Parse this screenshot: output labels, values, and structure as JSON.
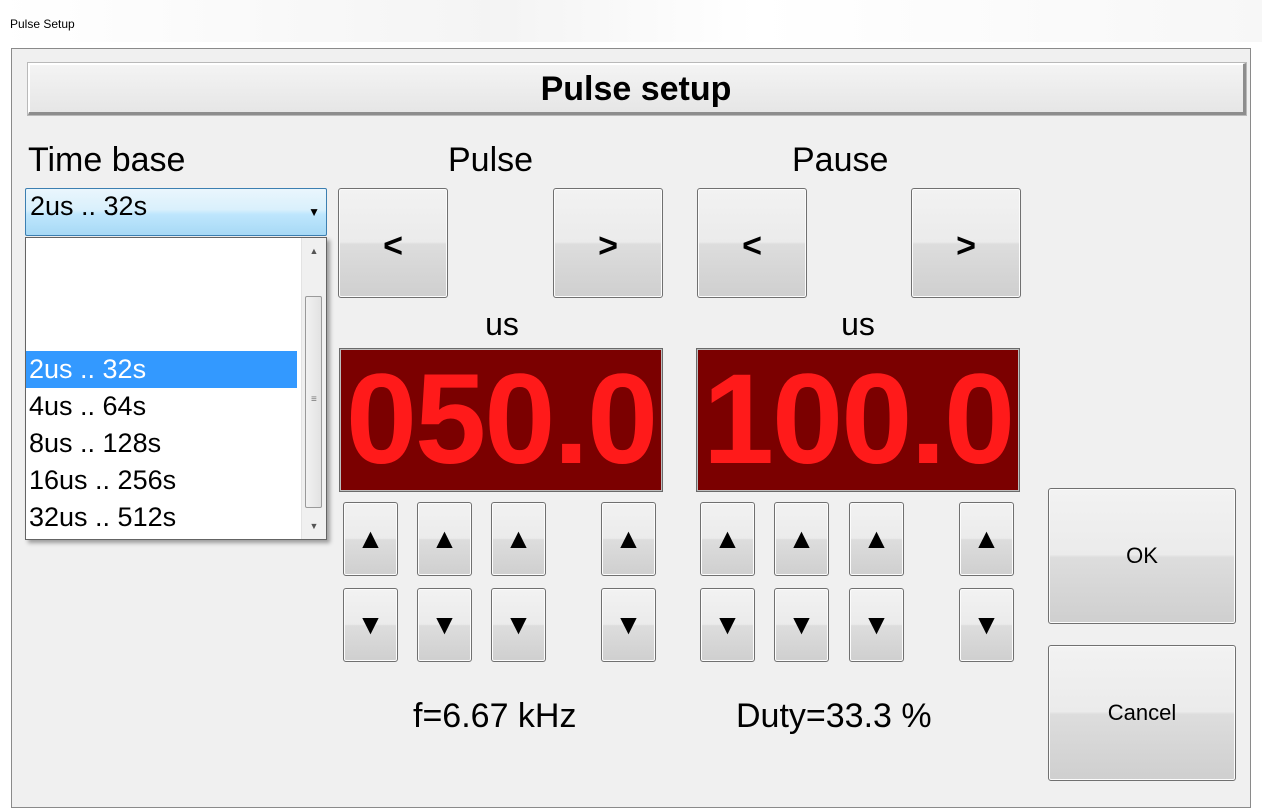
{
  "window": {
    "title": "Pulse Setup"
  },
  "header": {
    "title": "Pulse setup"
  },
  "time_base": {
    "label": "Time base",
    "selected": "2us .. 32s",
    "options": [
      "2us .. 32s",
      "4us .. 64s",
      "8us .. 128s",
      "16us .. 256s",
      "32us .. 512s"
    ]
  },
  "pulse": {
    "label": "Pulse",
    "prev": "<",
    "next": ">",
    "unit": "us",
    "value": "050.0"
  },
  "pause": {
    "label": "Pause",
    "prev": "<",
    "next": ">",
    "unit": "us",
    "value": "100.0"
  },
  "steppers": {
    "up": "▲",
    "down": "▼"
  },
  "status": {
    "frequency": "f=6.67 kHz",
    "duty": "Duty=33.3 %"
  },
  "buttons": {
    "ok": "OK",
    "cancel": "Cancel"
  },
  "colors": {
    "display_bg": "#7b0000",
    "display_fg": "#ff1a1a",
    "selection": "#3399ff"
  }
}
